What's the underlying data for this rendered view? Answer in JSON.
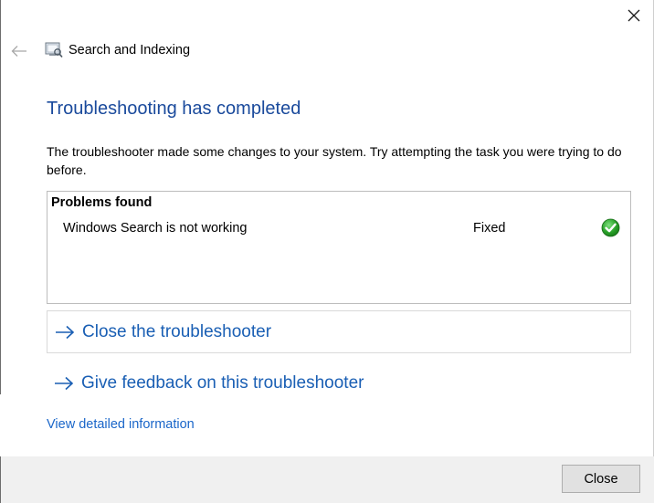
{
  "window": {
    "app_title": "Search and Indexing",
    "app_icon": "search-indexing-icon",
    "close_icon": "close-icon",
    "back_icon": "back-arrow-icon"
  },
  "main": {
    "heading": "Troubleshooting has completed",
    "description": "The troubleshooter made some changes to your system. Try attempting the task you were trying to do before."
  },
  "problems": {
    "header": "Problems found",
    "items": [
      {
        "name": "Windows Search is not working",
        "status": "Fixed",
        "status_icon": "check-icon"
      }
    ]
  },
  "actions": {
    "close_troubleshooter": "Close the troubleshooter",
    "give_feedback": "Give feedback on this troubleshooter",
    "view_details": "View detailed information"
  },
  "footer": {
    "close_label": "Close"
  },
  "colors": {
    "heading": "#1a4a9c",
    "link": "#1a5fb4",
    "status_green": "#2a9d2a",
    "footer_bg": "#f0f0f0"
  }
}
